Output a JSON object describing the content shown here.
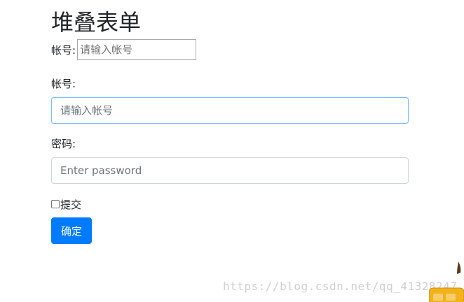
{
  "form": {
    "title": "堆叠表单",
    "inline": {
      "label": "帐号:",
      "placeholder": "请输入帐号"
    },
    "account": {
      "label": "帐号:",
      "placeholder": "请输入帐号"
    },
    "password": {
      "label": "密码:",
      "placeholder": "Enter password"
    },
    "checkbox": {
      "label": "提交",
      "checked": false
    },
    "submit_label": "确定"
  },
  "watermark": {
    "text": "https://blog.csdn.net/qq_41328247"
  },
  "colors": {
    "primary": "#007bff",
    "focus_border": "#80bdff",
    "border": "#ced4da",
    "text": "#212529",
    "watermark": "#d0d0d0"
  },
  "icons": {
    "corner": "mascot-badge-icon"
  }
}
